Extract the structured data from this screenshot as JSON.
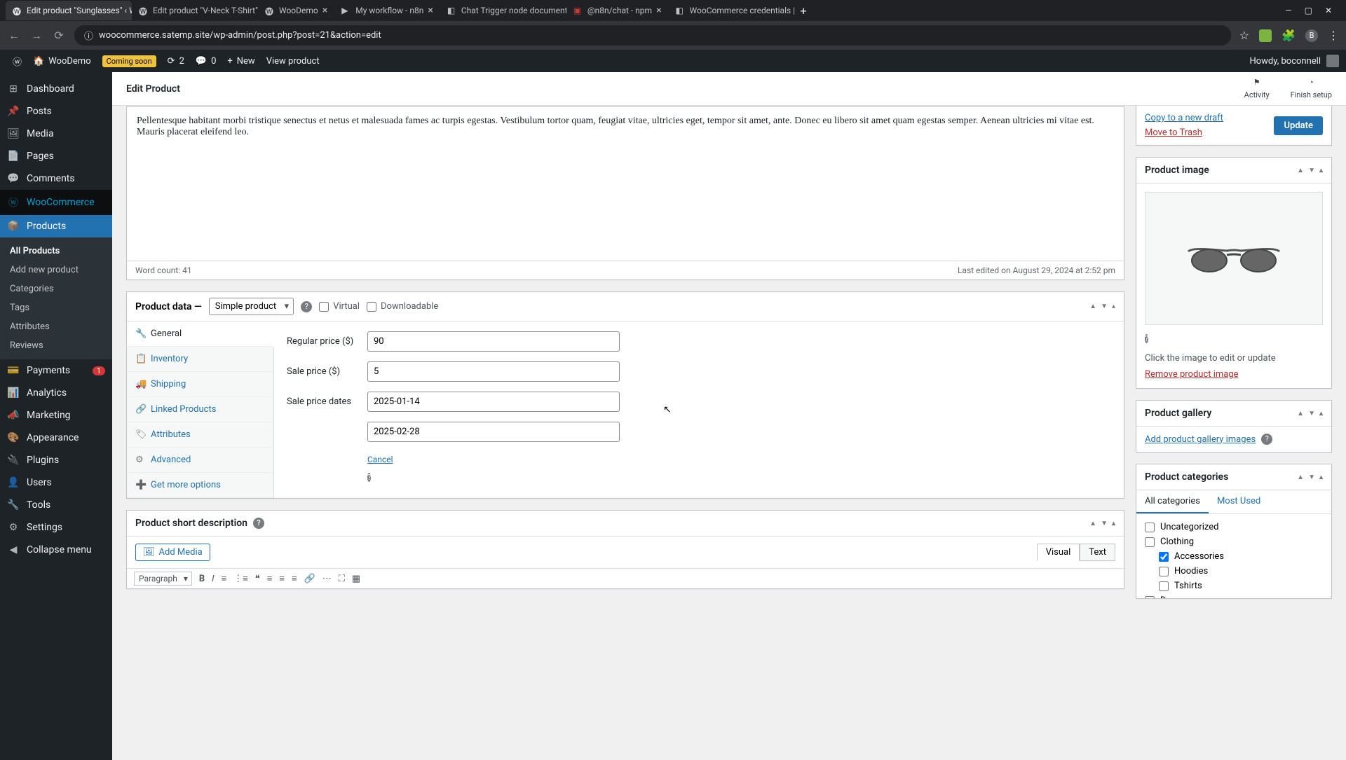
{
  "browser": {
    "tabs": [
      {
        "title": "Edit product \"Sunglasses\" ‹ Wo"
      },
      {
        "title": "Edit product \"V-Neck T-Shirt\""
      },
      {
        "title": "WooDemo"
      },
      {
        "title": "My workflow - n8n"
      },
      {
        "title": "Chat Trigger node documentat"
      },
      {
        "title": "@n8n/chat - npm"
      },
      {
        "title": "WooCommerce credentials | n"
      }
    ],
    "url": "woocommerce.satemp.site/wp-admin/post.php?post=21&action=edit"
  },
  "adminbar": {
    "site": "WooDemo",
    "coming_soon": "Coming soon",
    "updates": "2",
    "comments": "0",
    "new": "New",
    "view": "View product",
    "howdy": "Howdy, boconnell"
  },
  "menu": {
    "dashboard": "Dashboard",
    "posts": "Posts",
    "media": "Media",
    "pages": "Pages",
    "comments": "Comments",
    "woocommerce": "WooCommerce",
    "products": "Products",
    "submenu": {
      "all": "All Products",
      "add": "Add new product",
      "categories": "Categories",
      "tags": "Tags",
      "attributes": "Attributes",
      "reviews": "Reviews"
    },
    "payments": "Payments",
    "payments_badge": "1",
    "analytics": "Analytics",
    "marketing": "Marketing",
    "appearance": "Appearance",
    "plugins": "Plugins",
    "users": "Users",
    "tools": "Tools",
    "settings": "Settings",
    "collapse": "Collapse menu"
  },
  "header": {
    "title": "Edit Product",
    "activity": "Activity",
    "finish": "Finish setup"
  },
  "editor": {
    "content": "Pellentesque habitant morbi tristique senectus et netus et malesuada fames ac turpis egestas. Vestibulum tortor quam, feugiat vitae, ultricies eget, tempor sit amet, ante. Donec eu libero sit amet quam egestas semper. Aenean ultricies mi vitae est. Mauris placerat eleifend leo.",
    "wordcount": "Word count: 41",
    "lastedit": "Last edited on August 29, 2024 at 2:52 pm"
  },
  "product_data": {
    "title": "Product data —",
    "type": "Simple product",
    "virtual": "Virtual",
    "downloadable": "Downloadable",
    "tabs": {
      "general": "General",
      "inventory": "Inventory",
      "shipping": "Shipping",
      "linked": "Linked Products",
      "attributes": "Attributes",
      "advanced": "Advanced",
      "more": "Get more options"
    },
    "fields": {
      "regular_label": "Regular price ($)",
      "regular_value": "90",
      "sale_label": "Sale price ($)",
      "sale_value": "5",
      "dates_label": "Sale price dates",
      "date_from": "2025-01-14",
      "date_to": "2025-02-28",
      "cancel": "Cancel"
    }
  },
  "short_desc": {
    "title": "Product short description",
    "add_media": "Add Media",
    "visual": "Visual",
    "text": "Text",
    "paragraph": "Paragraph"
  },
  "publish": {
    "copy": "Copy to a new draft",
    "trash": "Move to Trash",
    "update": "Update"
  },
  "product_image": {
    "title": "Product image",
    "caption": "Click the image to edit or update",
    "remove": "Remove product image"
  },
  "gallery": {
    "title": "Product gallery",
    "add": "Add product gallery images"
  },
  "categories": {
    "title": "Product categories",
    "all_tab": "All categories",
    "most_tab": "Most Used",
    "items": {
      "uncategorized": "Uncategorized",
      "clothing": "Clothing",
      "accessories": "Accessories",
      "hoodies": "Hoodies",
      "tshirts": "Tshirts",
      "decor": "Decor"
    }
  }
}
